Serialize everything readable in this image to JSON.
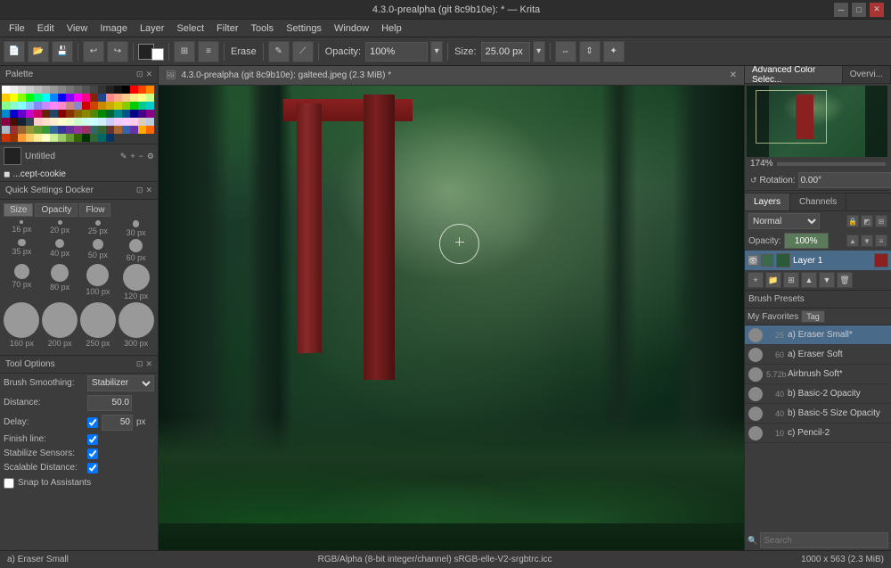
{
  "title_bar": {
    "title": "4.3.0-prealpha (git 8c9b10e): * — Krita",
    "minimize": "─",
    "maximize": "□",
    "close": "✕"
  },
  "menu": {
    "items": [
      "File",
      "Edit",
      "View",
      "Image",
      "Layer",
      "Select",
      "Filter",
      "Tools",
      "Settings",
      "Window",
      "Help"
    ]
  },
  "toolbar": {
    "opacity_label": "Opacity:",
    "opacity_value": "100%",
    "size_label": "Size:",
    "size_value": "25.00 px",
    "erase_label": "Erase"
  },
  "canvas_tab": {
    "title": "4.3.0-prealpha (git 8c9b10e): galteed.jpeg (2.3 MiB) *"
  },
  "left_panel": {
    "palette_header": "Palette",
    "palette_colors": [
      "#ffffff",
      "#eeeeee",
      "#dddddd",
      "#cccccc",
      "#bbbbbb",
      "#aaaaaa",
      "#999999",
      "#888888",
      "#777777",
      "#666666",
      "#555555",
      "#444444",
      "#333333",
      "#222222",
      "#111111",
      "#000000",
      "#ff0000",
      "#ff4400",
      "#ff8800",
      "#ffcc00",
      "#ffff00",
      "#88ff00",
      "#00ff00",
      "#00ff88",
      "#00ffff",
      "#0088ff",
      "#0000ff",
      "#8800ff",
      "#ff00ff",
      "#ff0088",
      "#882200",
      "#224488",
      "#ff8888",
      "#ffaa88",
      "#ffcc88",
      "#ffee88",
      "#ffff88",
      "#ccff88",
      "#88ff88",
      "#88ffcc",
      "#88ffff",
      "#88ccff",
      "#8888ff",
      "#cc88ff",
      "#ff88ff",
      "#ff88cc",
      "#cc8888",
      "#8888cc",
      "#cc0000",
      "#cc4400",
      "#cc8800",
      "#ccaa00",
      "#cccc00",
      "#88cc00",
      "#00cc00",
      "#00cc88",
      "#00cccc",
      "#0088cc",
      "#0000cc",
      "#6600cc",
      "#cc00cc",
      "#cc0066",
      "#662200",
      "#224466",
      "#880000",
      "#883300",
      "#886600",
      "#888800",
      "#558800",
      "#008800",
      "#006633",
      "#008888",
      "#005588",
      "#000088",
      "#440088",
      "#880088",
      "#880044",
      "#441100",
      "#112233",
      "#334455",
      "#ffcccc",
      "#ffddcc",
      "#ffeecc",
      "#ffffcc",
      "#eeffcc",
      "#ccffcc",
      "#ccffee",
      "#ccffff",
      "#cceeff",
      "#ccccff",
      "#eeccff",
      "#ffccff",
      "#ffccee",
      "#ddccbb",
      "#bbccdd",
      "#aabbcc",
      "#993333",
      "#996633",
      "#999933",
      "#669933",
      "#339933",
      "#336699",
      "#333399",
      "#663399",
      "#993399",
      "#993366",
      "#336666",
      "#336633",
      "#663333",
      "#aa6633",
      "#3366aa",
      "#6633aa",
      "#ffaa00",
      "#ff6600",
      "#cc3300",
      "#993300",
      "#ff9933",
      "#ffcc66",
      "#ffee99",
      "#ffffcc",
      "#ccee99",
      "#99cc66",
      "#669933",
      "#336600",
      "#003300",
      "#336633",
      "#006666",
      "#003366"
    ],
    "swatch_name": "Untitled",
    "layer_name": "...cept-cookie",
    "quick_settings_header": "Quick Settings Docker",
    "size_tab": "Size",
    "opacity_tab": "Opacity",
    "flow_tab": "Flow",
    "brushes": [
      {
        "size": 16,
        "label": "16 px"
      },
      {
        "size": 20,
        "label": "20 px"
      },
      {
        "size": 25,
        "label": "25 px"
      },
      {
        "size": 30,
        "label": "30 px"
      },
      {
        "size": 35,
        "label": "35 px"
      },
      {
        "size": 40,
        "label": "40 px"
      },
      {
        "size": 50,
        "label": "50 px"
      },
      {
        "size": 60,
        "label": "60 px"
      },
      {
        "size": 70,
        "label": "70 px"
      },
      {
        "size": 80,
        "label": "80 px"
      },
      {
        "size": 100,
        "label": "100 px"
      },
      {
        "size": 120,
        "label": "120 px"
      },
      {
        "size": 160,
        "label": "160 px"
      },
      {
        "size": 200,
        "label": "200 px"
      },
      {
        "size": 250,
        "label": "250 px"
      },
      {
        "size": 300,
        "label": "300 px"
      }
    ],
    "tool_options_header": "Tool Options",
    "brush_smoothing_label": "Brush Smoothing:",
    "brush_smoothing_value": "Stabilizer",
    "distance_label": "Distance:",
    "distance_value": "50.0",
    "delay_label": "Delay:",
    "delay_value": "50",
    "delay_unit": "px",
    "finish_line_label": "Finish line:",
    "stabilize_sensors_label": "Stabilize Sensors:",
    "scalable_distance_label": "Scalable Distance:",
    "snap_label": "Snap to Assistants"
  },
  "right_panel": {
    "adv_color_tab": "Advanced Color Selec...",
    "overview_tab": "Overvi...",
    "zoom_pct": "174%",
    "rotation_label": "Rotation:",
    "rotation_value": "0.00°",
    "layers_tab": "Layers",
    "channels_tab": "Channels",
    "blend_mode": "Normal",
    "opacity_label": "Opacity:",
    "opacity_value": "100%",
    "layer_name": "Layer 1",
    "brush_presets_header": "Brush Presets",
    "my_favorites_label": "My Favorites",
    "tag_btn": "Tag",
    "brush_items": [
      {
        "num": "25",
        "name": "a) Eraser Small*",
        "selected": true
      },
      {
        "num": "60",
        "name": "a) Eraser Soft",
        "selected": false
      },
      {
        "num": "5.72b",
        "name": "Airbrush Soft*",
        "selected": false
      },
      {
        "num": "40",
        "name": "b) Basic-2 Opacity",
        "selected": false
      },
      {
        "num": "40",
        "name": "b) Basic-5 Size Opacity",
        "selected": false
      },
      {
        "num": "10",
        "name": "c) Pencil-2",
        "selected": false
      }
    ],
    "search_placeholder": "Search"
  },
  "status_bar": {
    "tool": "a) Eraser Small",
    "color_mode": "RGB/Alpha (8-bit integer/channel) sRGB-elle-V2-srgbtrc.icc",
    "dimensions": "1000 x 563 (2.3 MiB)"
  }
}
